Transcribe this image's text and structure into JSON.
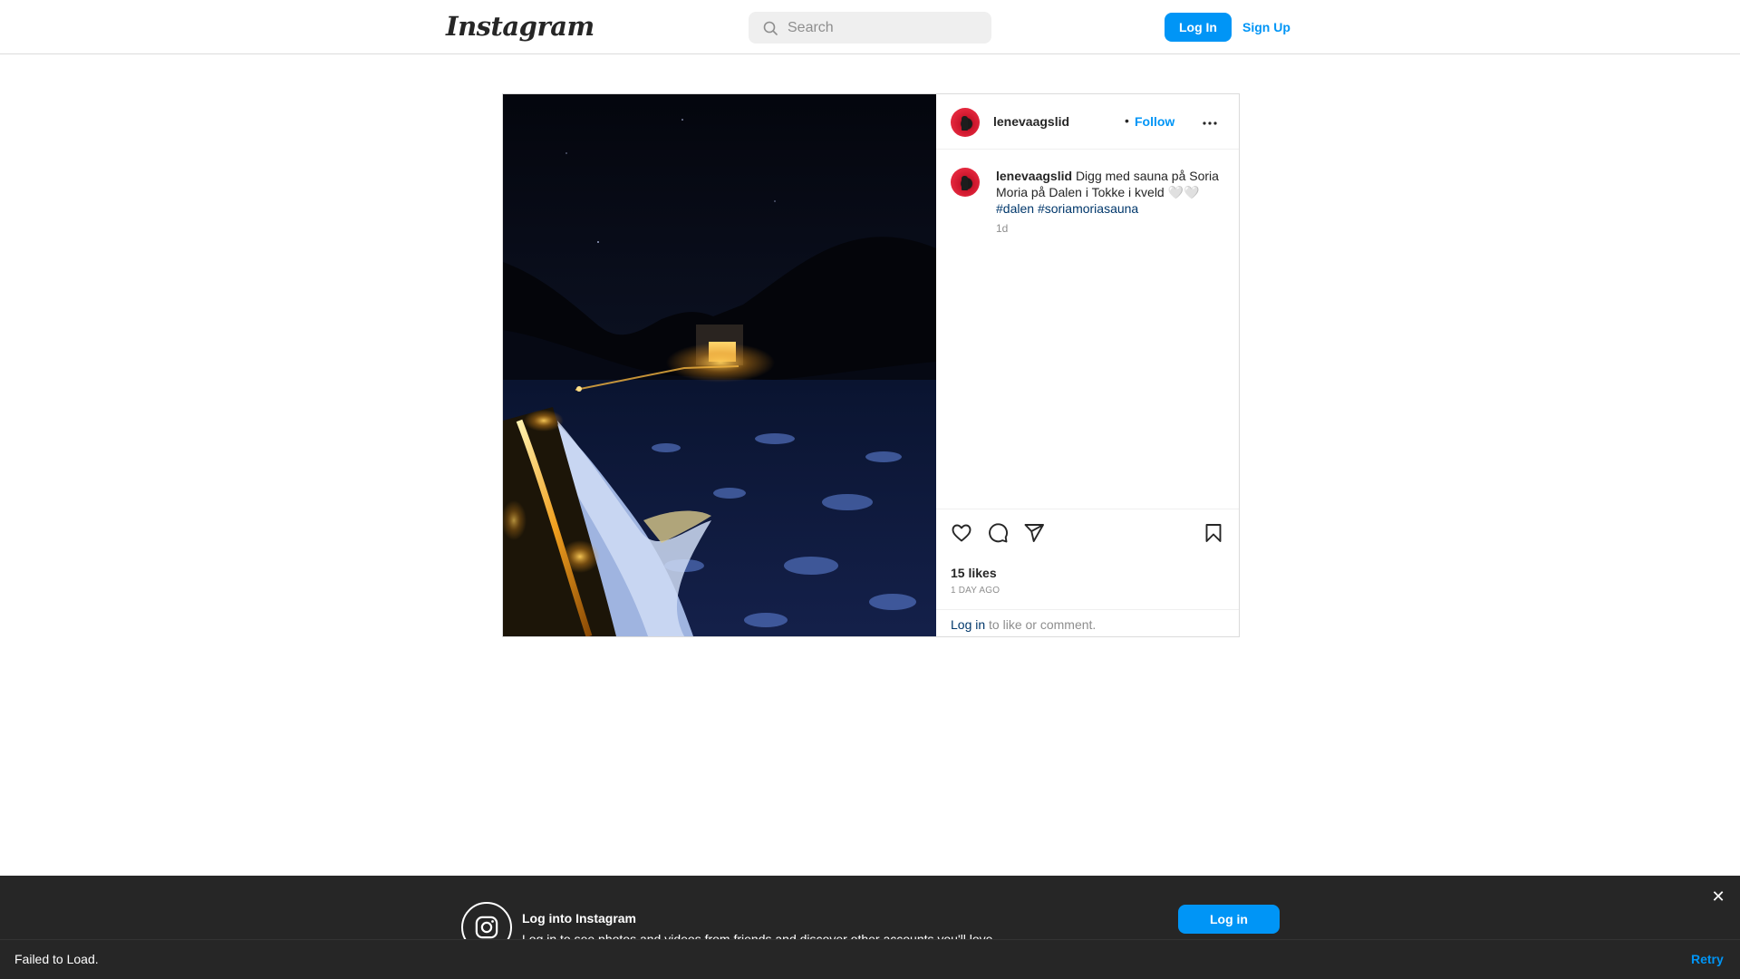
{
  "nav": {
    "logo_text": "Instagram",
    "search_placeholder": "Search",
    "login_label": "Log In",
    "signup_label": "Sign Up"
  },
  "post": {
    "username": "lenevaagslid",
    "separator": "•",
    "follow_label": "Follow",
    "caption_user": "lenevaagslid",
    "caption_text": "Digg med sauna på Soria Moria på Dalen i Tokke i kveld 🤍🤍",
    "hashtags": [
      "#dalen",
      "#soriamoriasauna"
    ],
    "caption_age": "1d",
    "likes": "15 likes",
    "posted_ago": "1 DAY AGO",
    "comment_login": "Log in",
    "comment_suffix": " to like or comment."
  },
  "banner": {
    "title": "Log into Instagram",
    "subtitle": "Log in to see photos and videos from friends and discover other accounts you'll love.",
    "login_label": "Log in",
    "close_symbol": "✕"
  },
  "toast": {
    "message": "Failed to Load.",
    "retry_label": "Retry"
  },
  "colors": {
    "accent": "#0095f6",
    "link": "#00376b",
    "banner_bg": "#262626"
  },
  "icons": {
    "search": "search-icon",
    "more": "more-options-icon",
    "like": "heart-icon",
    "comment": "comment-icon",
    "share": "share-icon",
    "save": "bookmark-icon",
    "instagram": "instagram-glyph-icon"
  }
}
